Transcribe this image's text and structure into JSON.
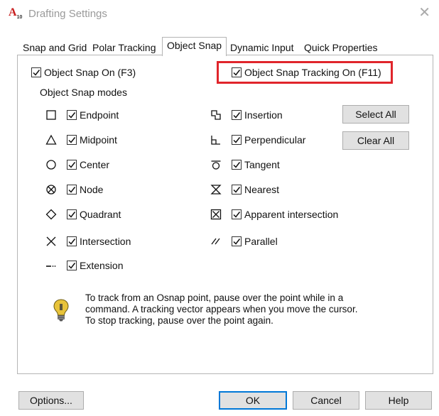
{
  "window": {
    "title": "Drafting Settings",
    "app_icon_text": "A",
    "app_icon_sub": "10",
    "close_glyph": "✕"
  },
  "tabs": [
    {
      "label": "Snap and Grid",
      "active": false
    },
    {
      "label": "Polar Tracking",
      "active": false
    },
    {
      "label": "Object Snap",
      "active": true
    },
    {
      "label": "Dynamic Input",
      "active": false
    },
    {
      "label": "Quick Properties",
      "active": false
    }
  ],
  "object_snap": {
    "snap_on": {
      "label": "Object Snap On (F3)",
      "checked": true
    },
    "tracking_on": {
      "label": "Object Snap Tracking On (F11)",
      "checked": true,
      "highlight_color": "#e0252b"
    },
    "modes_heading": "Object Snap modes",
    "left_modes": [
      {
        "icon": "square-icon",
        "label": "Endpoint",
        "checked": true
      },
      {
        "icon": "triangle-icon",
        "label": "Midpoint",
        "checked": true
      },
      {
        "icon": "circle-icon",
        "label": "Center",
        "checked": true
      },
      {
        "icon": "node-icon",
        "label": "Node",
        "checked": true
      },
      {
        "icon": "diamond-icon",
        "label": "Quadrant",
        "checked": true
      },
      {
        "icon": "x-icon",
        "label": "Intersection",
        "checked": true
      },
      {
        "icon": "extension-icon",
        "label": "Extension",
        "checked": true
      }
    ],
    "right_modes": [
      {
        "icon": "insertion-icon",
        "label": "Insertion",
        "checked": true
      },
      {
        "icon": "perpendicular-icon",
        "label": "Perpendicular",
        "checked": true
      },
      {
        "icon": "tangent-icon",
        "label": "Tangent",
        "checked": true
      },
      {
        "icon": "nearest-icon",
        "label": "Nearest",
        "checked": true
      },
      {
        "icon": "apparent-intersection-icon",
        "label": "Apparent intersection",
        "checked": true
      },
      {
        "icon": "parallel-icon",
        "label": "Parallel",
        "checked": true
      }
    ],
    "select_all_label": "Select All",
    "clear_all_label": "Clear All",
    "info_lines": [
      "To track from an Osnap point, pause over the point while in a",
      "command.  A tracking vector appears when you move the cursor.",
      "To stop tracking, pause over the point again."
    ]
  },
  "footer": {
    "options_label": "Options...",
    "ok_label": "OK",
    "cancel_label": "Cancel",
    "help_label": "Help"
  },
  "colors": {
    "accent": "#0078d7",
    "highlight": "#e0252b",
    "bulb": "#e8c33a"
  }
}
